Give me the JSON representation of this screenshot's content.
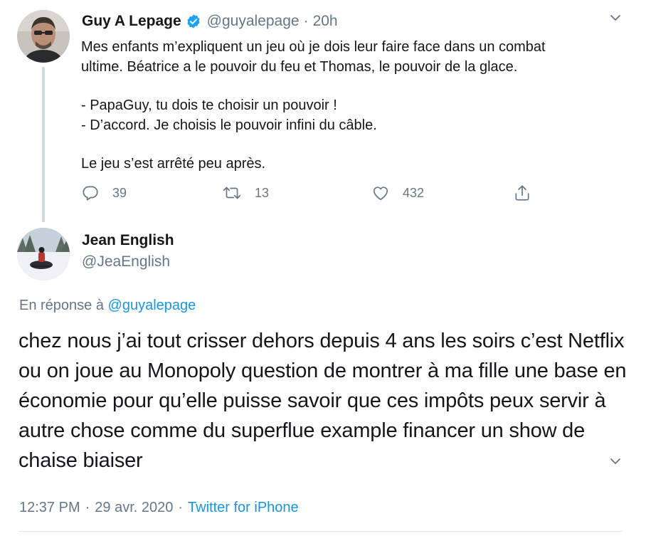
{
  "parent_tweet": {
    "author_name": "Guy A Lepage",
    "author_handle": "@guyalepage",
    "separator": "·",
    "time_ago": "20h",
    "lines": [
      "Mes enfants m’expliquent un jeu où je dois leur faire face dans un combat",
      "ultime. Béatrice a le pouvoir du feu et Thomas, le pouvoir de la glace.",
      "",
      "- PapaGuy, tu dois te choisir un pouvoir !",
      "- D’accord. Je choisis le pouvoir infini du câble.",
      "",
      "Le jeu s’est arrêté peu après."
    ],
    "reply_count": "39",
    "retweet_count": "13",
    "like_count": "432",
    "icons": {
      "reply": "reply-icon",
      "retweet": "retweet-icon",
      "like": "heart-icon",
      "share": "share-icon",
      "verified": "verified-badge-icon",
      "menu": "chevron-down-icon"
    }
  },
  "reply_tweet": {
    "author_name": "Jean English",
    "author_handle": "@JeaEnglish",
    "in_reply_prefix": "En réponse à",
    "in_reply_mention": "@guyalepage",
    "text": "chez nous j’ai tout crisser dehors depuis 4 ans les soirs c’est Netflix ou on joue au Monopoly question de montrer à ma fille une base en économie pour qu’elle puisse savoir que ces impôts peux servir à autre chose comme du superflue example financer un show de chaise biaiser",
    "time": "12:37 PM",
    "separator": "·",
    "date": "29 avr. 2020",
    "source": "Twitter for iPhone"
  },
  "colors": {
    "text": "#14171a",
    "muted": "#657786",
    "link": "#1b95e0",
    "thread_line": "#cfd9de",
    "divider": "#e1e8ed"
  }
}
